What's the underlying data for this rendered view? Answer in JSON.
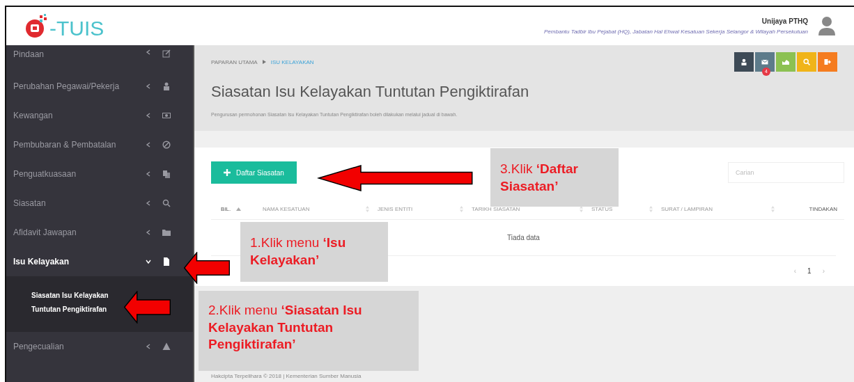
{
  "header": {
    "logo": "-TUIS",
    "user_name": "Unijaya PTHQ",
    "user_role": "Pembantu Tadbir Ibu Pejabat (HQ), Jabatan Hal Ehwal Kesatuan Sekerja Selangor & Wilayah Persekutuan"
  },
  "sidebar": {
    "items": [
      {
        "label": "Pindaan",
        "expanded": false,
        "selected": false
      },
      {
        "label": "Perubahan Pegawai/Pekerja",
        "expanded": false,
        "selected": false
      },
      {
        "label": "Kewangan",
        "expanded": false,
        "selected": false
      },
      {
        "label": "Pembubaran & Pembatalan",
        "expanded": false,
        "selected": false
      },
      {
        "label": "Penguatkuasaan",
        "expanded": false,
        "selected": false
      },
      {
        "label": "Siasatan",
        "expanded": false,
        "selected": false
      },
      {
        "label": "Afidavit Jawapan",
        "expanded": false,
        "selected": false
      },
      {
        "label": "Isu Kelayakan",
        "expanded": true,
        "selected": true,
        "children": [
          {
            "label": "Siasatan Isu Kelayakan Tuntutan Pengiktirafan",
            "selected": true
          }
        ]
      },
      {
        "label": "Pengecualian",
        "expanded": false,
        "selected": false
      }
    ]
  },
  "breadcrumb": [
    {
      "label": "PAPARAN UTAMA",
      "selected": false
    },
    {
      "label": "ISU KELAYAKAN",
      "selected": true
    }
  ],
  "toolbar": [
    {
      "color": "#3d4a56"
    },
    {
      "color": "#5d7b8a",
      "badge": "4"
    },
    {
      "color": "#8cc152"
    },
    {
      "color": "#f0b419"
    },
    {
      "color": "#f57c1f"
    }
  ],
  "page_title": "Siasatan Isu Kelayakan Tuntutan Pengiktirafan",
  "page_subtitle": "Pengurusan permohonan Siasatan Isu Kelayakan Tuntutan Pengiktirafan boleh dilakukan melalui jadual di bawah.",
  "add_button": "Daftar Siasatan",
  "search": {
    "placeholder": "Carian"
  },
  "table": {
    "columns": [
      {
        "label": "BIL."
      },
      {
        "label": "NAMA KESATUAN"
      },
      {
        "label": "JENIS ENTITI"
      },
      {
        "label": "TARIKH SIASATAN"
      },
      {
        "label": "STATUS"
      },
      {
        "label": "SURAT / LAMPIRAN"
      },
      {
        "label": "TINDAKAN"
      }
    ],
    "empty_text": "Tiada data"
  },
  "pagination": {
    "prev": "‹",
    "pages": [
      {
        "label": "1",
        "selected": true
      }
    ],
    "next": "›"
  },
  "footer": "Hakcipta Terpelihara © 2018 | Kementerian Sumber Manusia",
  "callouts": [
    {
      "text": "1.Klik menu **‘Isu Kelayakan’**"
    },
    {
      "text": "2.Klik menu **‘Siasatan Isu Kelayakan Tuntutan Pengiktirafan’**"
    },
    {
      "text": "3.Klik **‘Daftar Siasatan’**"
    }
  ]
}
